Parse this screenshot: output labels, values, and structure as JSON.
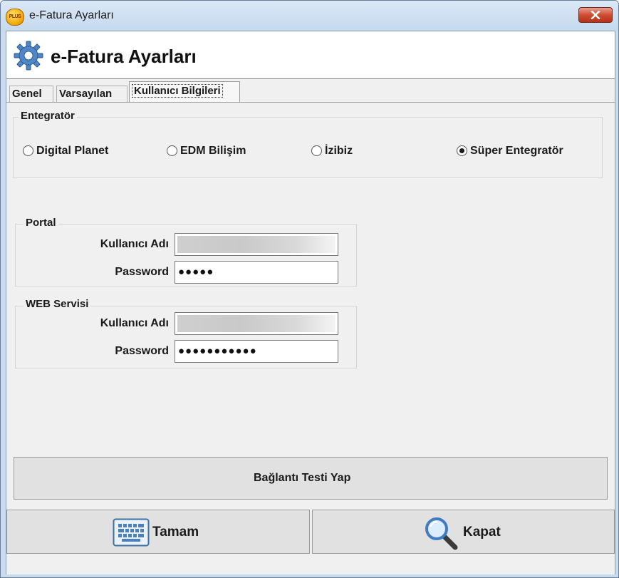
{
  "window": {
    "title": "e-Fatura Ayarları",
    "app_icon_text": "PLUS"
  },
  "header": {
    "title": "e-Fatura Ayarları"
  },
  "tabs": [
    {
      "label": "Genel",
      "active": false
    },
    {
      "label": "Varsayılan",
      "active": false
    },
    {
      "label": "Kullanıcı Bilgileri",
      "active": true
    }
  ],
  "integrator": {
    "legend": "Entegratör",
    "options": [
      {
        "label": "Digital Planet",
        "selected": false
      },
      {
        "label": "EDM Bilişim",
        "selected": false
      },
      {
        "label": "İzibiz",
        "selected": false
      },
      {
        "label": "Süper Entegratör",
        "selected": true
      }
    ]
  },
  "portal": {
    "legend": "Portal",
    "username_label": "Kullanıcı Adı",
    "username_value": "",
    "password_label": "Password",
    "password_value": "●●●●●"
  },
  "web_service": {
    "legend": "WEB Servisi",
    "username_label": "Kullanıcı Adı",
    "username_value": "",
    "password_label": "Password",
    "password_value": "●●●●●●●●●●●"
  },
  "buttons": {
    "test_connection": "Bağlantı Testi Yap",
    "ok": "Tamam",
    "close": "Kapat"
  },
  "icons": {
    "window_close": "close-icon",
    "header": "gear-icon",
    "ok": "keyboard-icon",
    "close": "magnifier-icon"
  }
}
